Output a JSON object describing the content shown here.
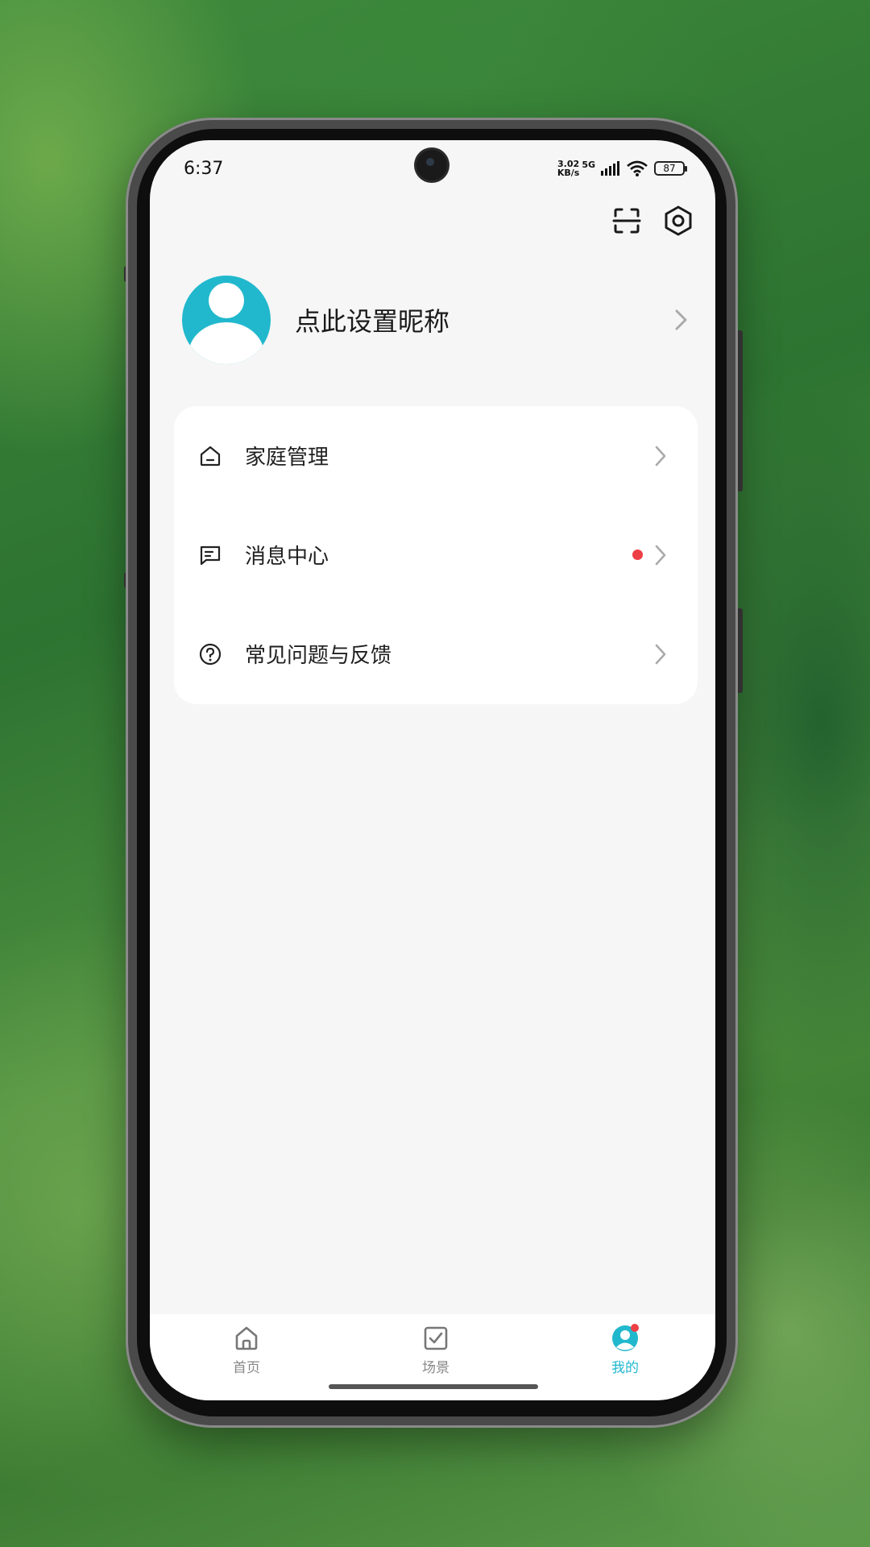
{
  "status_bar": {
    "time": "6:37",
    "net_speed_value": "3.02",
    "net_speed_unit": "KB/s",
    "network": "5G",
    "battery": "87"
  },
  "header": {
    "scan_icon": "scan-icon",
    "settings_icon": "settings-icon"
  },
  "profile": {
    "nickname": "点此设置昵称"
  },
  "menu": {
    "items": [
      {
        "label": "家庭管理",
        "icon": "home-icon",
        "badge": false
      },
      {
        "label": "消息中心",
        "icon": "message-icon",
        "badge": true
      },
      {
        "label": "常见问题与反馈",
        "icon": "help-icon",
        "badge": false
      }
    ]
  },
  "tabbar": {
    "tabs": [
      {
        "label": "首页",
        "icon": "home-icon",
        "active": false
      },
      {
        "label": "场景",
        "icon": "checkbox-icon",
        "active": false
      },
      {
        "label": "我的",
        "icon": "user-icon",
        "active": true,
        "badge": true
      }
    ]
  },
  "colors": {
    "accent": "#21b8cd",
    "badge": "#ee3f45",
    "background": "#f6f6f6"
  }
}
